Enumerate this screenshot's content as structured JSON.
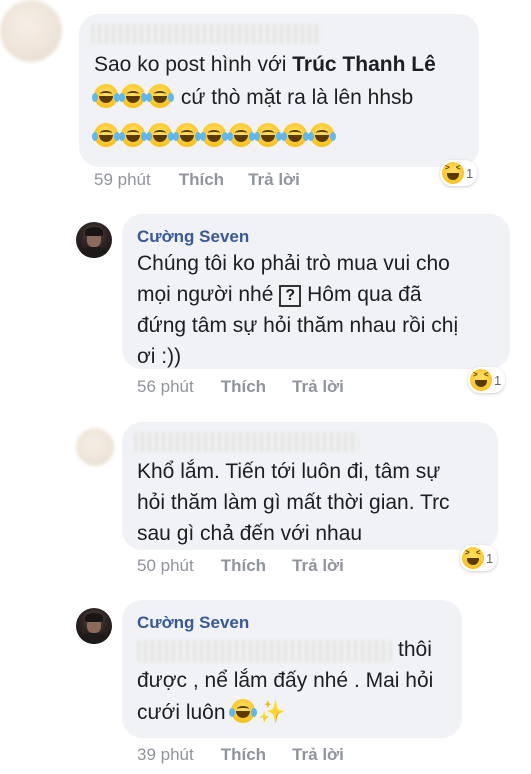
{
  "comments": [
    {
      "author": "",
      "line1_prefix": "Sao ko post hình với",
      "line1_mention": "Trúc Thanh Lê",
      "line2_text": "cứ thò mặt ra là lên hhsb",
      "time": "59 phút",
      "like_label": "Thích",
      "reply_label": "Trả lời",
      "reaction_count": "1",
      "emoji_icon": "tears-of-joy-icon"
    },
    {
      "author": "Cường Seven",
      "line1": "Chúng tôi ko phải trò mua vui cho",
      "line2_a": "mọi người nhé",
      "line2_qbox": "?",
      "line2_b": "Hôm qua đã",
      "line3": "đứng tâm sự hỏi thăm nhau rồi chị",
      "line4": "ơi :))",
      "time": "56 phút",
      "like_label": "Thích",
      "reply_label": "Trả lời",
      "reaction_count": "1"
    },
    {
      "author": "",
      "line1": "Khổ lắm. Tiến tới luôn đi, tâm sự",
      "line2": "hỏi thăm làm gì mất thời gian. Trc",
      "line3": "sau gì chả đến với nhau",
      "time": "50 phút",
      "like_label": "Thích",
      "reply_label": "Trả lời",
      "reaction_count": "1"
    },
    {
      "author": "Cường Seven",
      "line1_tail": "thôi",
      "line2": "được , nể lắm đấy nhé . Mai hỏi",
      "line3": "cưới luôn",
      "time": "39 phút",
      "like_label": "Thích",
      "reply_label": "Trả lời"
    }
  ]
}
